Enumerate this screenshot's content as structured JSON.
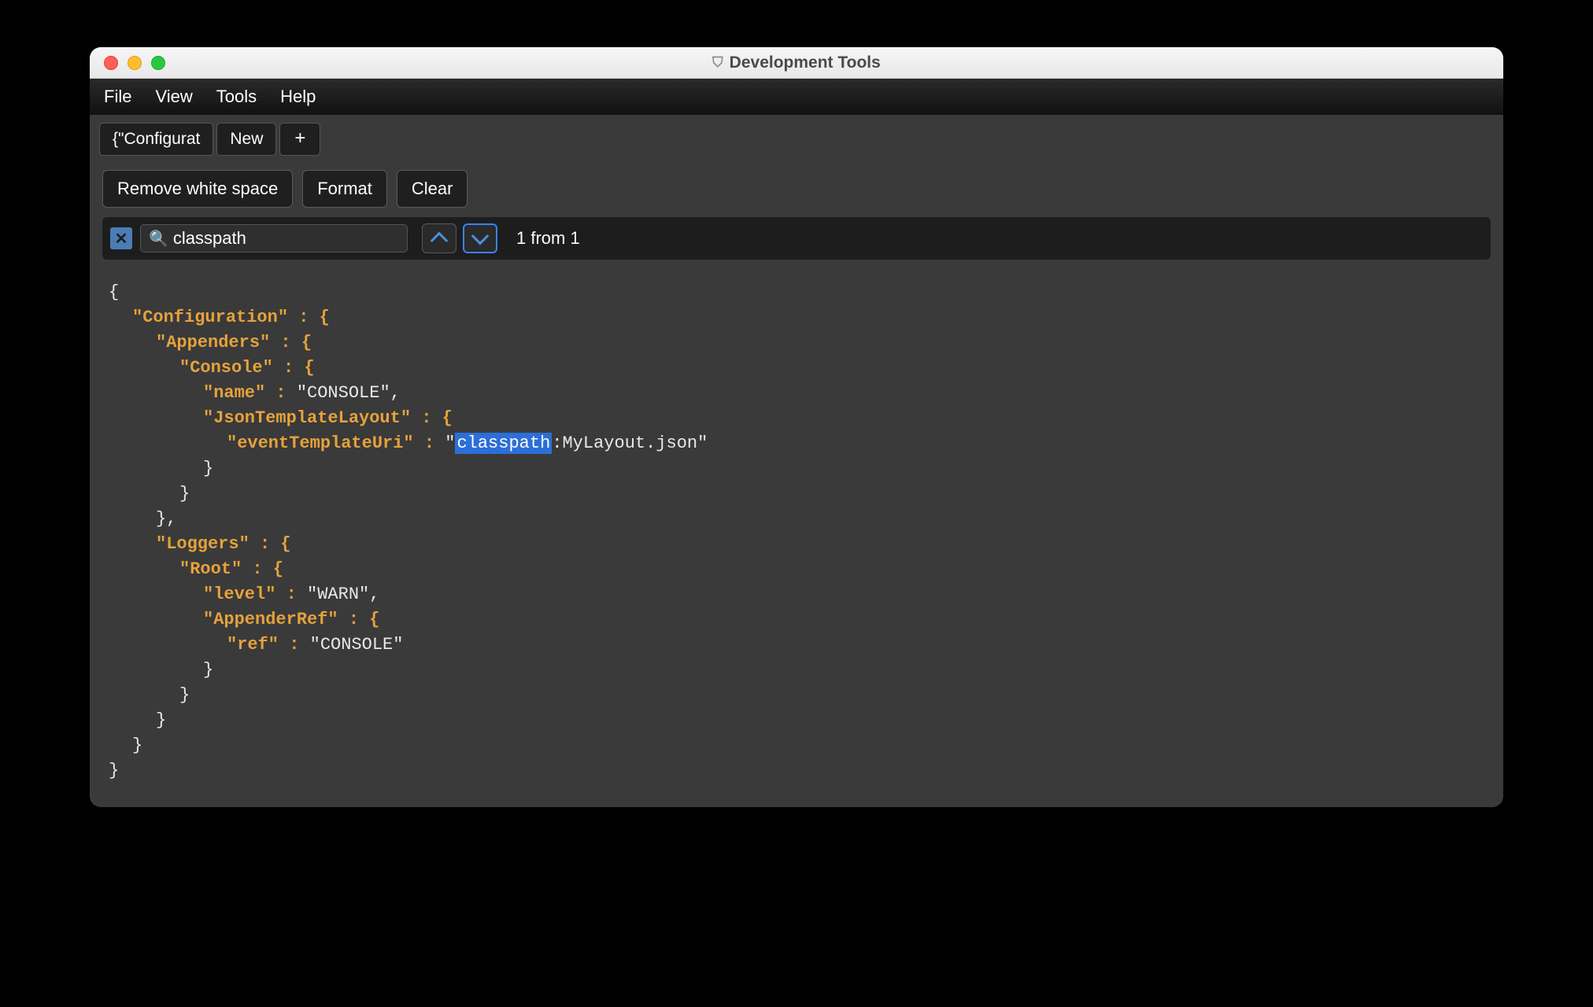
{
  "window": {
    "title": "Development Tools"
  },
  "menus": {
    "file": "File",
    "view": "View",
    "tools": "Tools",
    "help": "Help"
  },
  "tabs": {
    "tab1": "{\"Configurat",
    "tab2": "New",
    "add": "+"
  },
  "toolbar": {
    "remove_ws": "Remove white space",
    "format": "Format",
    "clear": "Clear"
  },
  "search": {
    "close": "✕",
    "placeholder": "",
    "value": "classpath",
    "results": "1 from 1"
  },
  "code": {
    "l0": "{",
    "l1_key": "\"Configuration\"",
    "l1_rest": " : {",
    "l2_key": "\"Appenders\"",
    "l2_rest": " : {",
    "l3_key": "\"Console\"",
    "l3_rest": " : {",
    "l4_key": "\"name\"",
    "l4_colon": " : ",
    "l4_val": "\"CONSOLE\"",
    "l4_comma": ",",
    "l5_key": "\"JsonTemplateLayout\"",
    "l5_rest": " : {",
    "l6_key": "\"eventTemplateUri\"",
    "l6_colon": " : ",
    "l6_q1": "\"",
    "l6_hl": "classpath",
    "l6_rest": ":MyLayout.json\"",
    "l7": "}",
    "l8": "}",
    "l9": "},",
    "l10_key": "\"Loggers\"",
    "l10_rest": " : {",
    "l11_key": "\"Root\"",
    "l11_rest": " : {",
    "l12_key": "\"level\"",
    "l12_colon": " : ",
    "l12_val": "\"WARN\"",
    "l12_comma": ",",
    "l13_key": "\"AppenderRef\"",
    "l13_rest": " : {",
    "l14_key": "\"ref\"",
    "l14_colon": " : ",
    "l14_val": "\"CONSOLE\"",
    "l15": "}",
    "l16": "}",
    "l17": "}",
    "l18": "}",
    "l19": "}"
  }
}
